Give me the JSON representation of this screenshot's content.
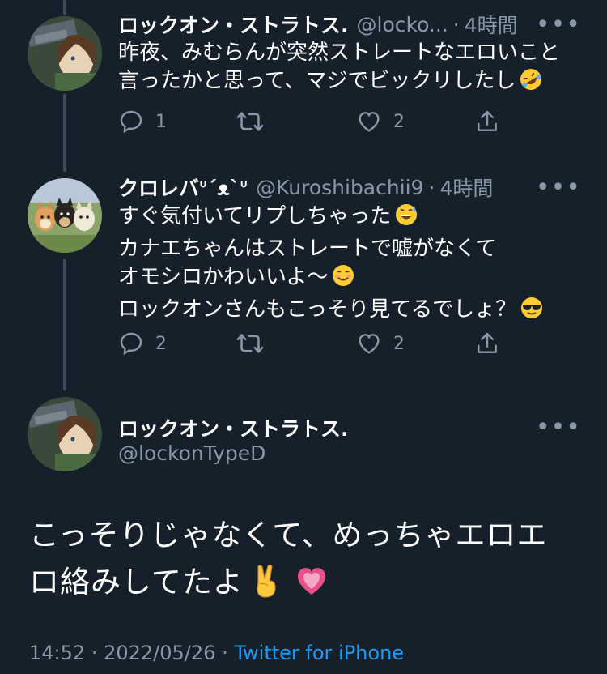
{
  "tweets": [
    {
      "name": "ロックオン・ストラトス.",
      "handle": "@locko...",
      "separator": "·",
      "time": "4時間",
      "lines": [
        "昨夜、みむらんが突然ストレートなエロいこと",
        "言ったかと思って、マジでビックリしたし"
      ],
      "emoji_line2": "rolling-on-floor-laughing-emoji",
      "reply_count": "1",
      "retweet_count": "",
      "like_count": "2"
    },
    {
      "name": "クロレバᐡ´ᴥ`ᐡ",
      "handle": "@Kuroshibachii9",
      "separator": "·",
      "time": "4時間",
      "lines": [
        "すぐ気付いてリプしちゃった",
        "カナエちゃんはストレートで嘘がなくて",
        "オモシロかわいいよ〜",
        "ロックオンさんもこっそり見てるでしょ？"
      ],
      "reply_count": "2",
      "retweet_count": "",
      "like_count": "2"
    }
  ],
  "main_tweet": {
    "name": "ロックオン・ストラトス.",
    "handle": "@lockonTypeD",
    "lines": [
      "こっそりじゃなくて、めっちゃエロエ",
      "ロ絡みしてたよ"
    ],
    "time": "14:52",
    "separator": "·",
    "date": "2022/05/26",
    "source": "Twitter for iPhone"
  },
  "icons": {
    "more": "more-dots-icon",
    "reply": "reply-bubble-icon",
    "retweet": "retweet-icon",
    "like": "heart-icon",
    "share": "share-icon"
  },
  "colors": {
    "background": "#15202b",
    "secondary_text": "#8899a6",
    "link": "#1d9bf0",
    "thread_line": "#3d4b5c"
  }
}
